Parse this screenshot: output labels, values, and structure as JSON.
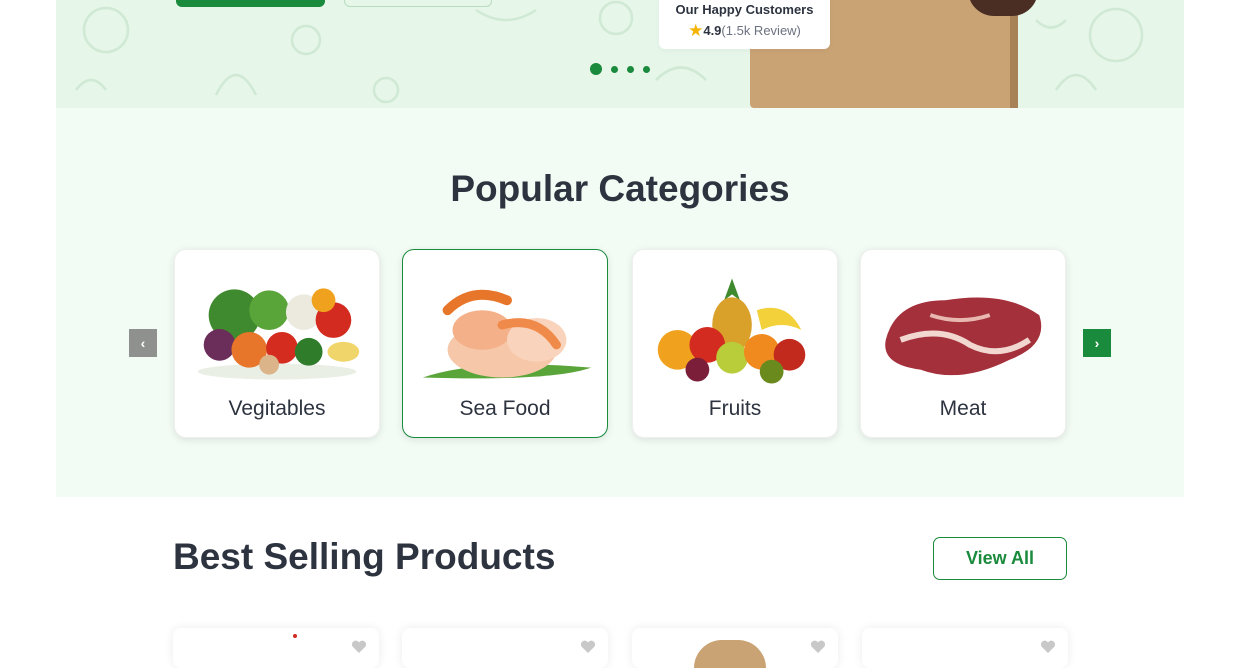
{
  "hero": {
    "review_title": "Our Happy Customers",
    "rating": "4.9",
    "review_count": "(1.5k Review)",
    "slides": 4,
    "active_slide": 1
  },
  "categories": {
    "title": "Popular Categories",
    "items": [
      {
        "label": "Vegitables",
        "selected": false
      },
      {
        "label": "Sea Food",
        "selected": true
      },
      {
        "label": "Fruits",
        "selected": false
      },
      {
        "label": "Meat",
        "selected": false
      }
    ],
    "prev_icon": "chevron-left-icon",
    "next_icon": "chevron-right-icon"
  },
  "best_selling": {
    "title": "Best Selling Products",
    "view_all_label": "View All",
    "product_icon": "heart-icon"
  },
  "colors": {
    "brand_green": "#1a8a3c",
    "hero_bg": "#e6f6e9",
    "section_bg": "#f3fbf5",
    "star": "#f5b400"
  }
}
